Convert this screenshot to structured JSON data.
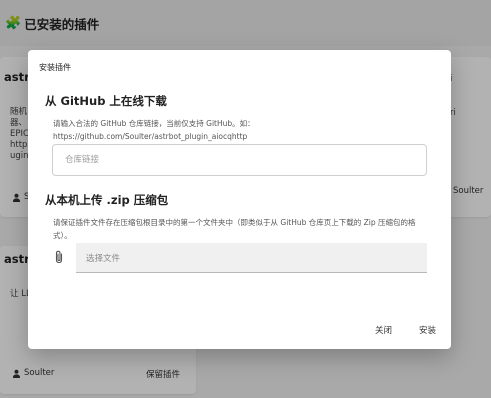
{
  "header": {
    "title": "已安装的插件"
  },
  "cards": [
    {
      "title": "astrl",
      "desc_lines": [
        "随机",
        "器、",
        "EPIC",
        "http",
        "ugin"
      ],
      "author": "Sc",
      "action": ""
    },
    {
      "title": "astrl",
      "desc_lines": [
        "让 LL"
      ],
      "author": "Soulter",
      "action": "保留插件"
    },
    {
      "title": "",
      "desc_lines": [
        "i",
        "",
        "ri"
      ],
      "author": "Soulter",
      "action": ""
    }
  ],
  "dialog": {
    "title": "安装插件",
    "github": {
      "heading": "从 GitHub 上在线下载",
      "description": "请输入合法的 GitHub 仓库链接，当前仅支持 GitHub。如：https://github.com/Soulter/astrbot_plugin_aiocqhttp",
      "input_value": "",
      "input_placeholder": "仓库链接"
    },
    "local": {
      "heading": "从本机上传 .zip 压缩包",
      "description": "请保证插件文件存在压缩包根目录中的第一个文件夹中（即类似于从 GitHub 仓库页上下载的 Zip 压缩包的格式）。",
      "file_placeholder": "选择文件"
    },
    "buttons": {
      "close": "关闭",
      "install": "安装"
    }
  }
}
